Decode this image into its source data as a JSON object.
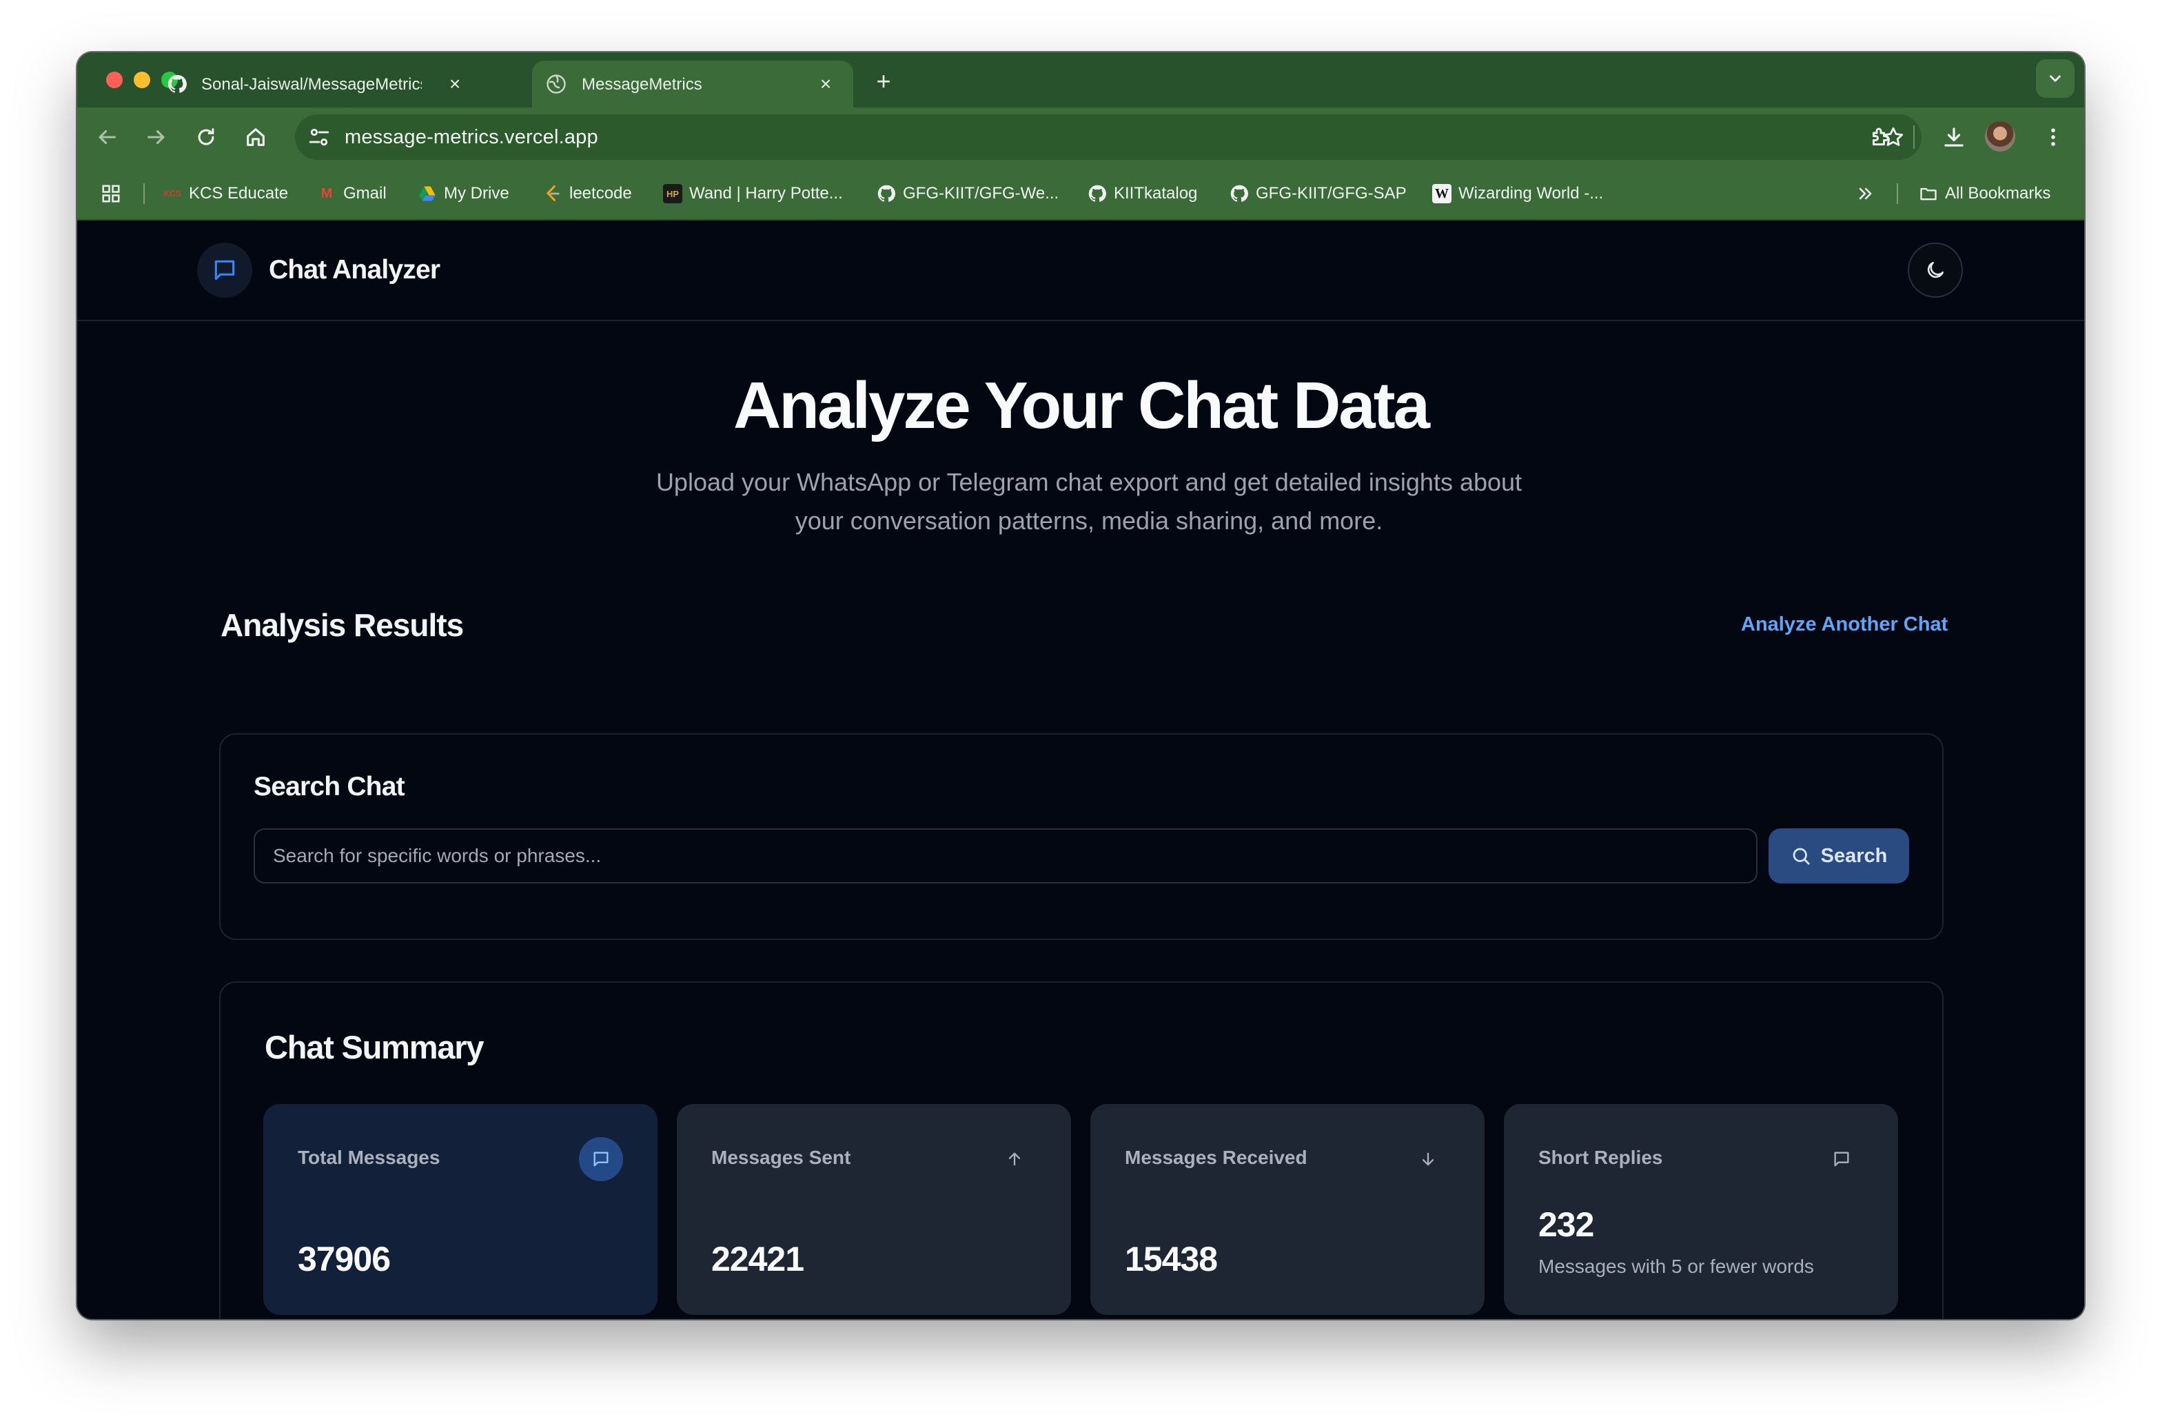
{
  "browser": {
    "tabs": [
      {
        "title": "Sonal-Jaiswal/MessageMetrics",
        "icon": "github-icon"
      },
      {
        "title": "MessageMetrics",
        "icon": "globe-icon"
      }
    ],
    "url": "message-metrics.vercel.app",
    "bookmarks": [
      {
        "label": "KCS Educate",
        "icon": "kcs-icon",
        "icon_text": "KCS"
      },
      {
        "label": "Gmail",
        "icon": "gmail-icon",
        "icon_text": "M"
      },
      {
        "label": "My Drive",
        "icon": "drive-icon"
      },
      {
        "label": "leetcode",
        "icon": "leetcode-icon"
      },
      {
        "label": "Wand | Harry Potte...",
        "icon": "hp-icon",
        "icon_text": "HP"
      },
      {
        "label": "GFG-KIIT/GFG-We...",
        "icon": "github-icon"
      },
      {
        "label": "KIITkatalog",
        "icon": "github-icon"
      },
      {
        "label": "GFG-KIIT/GFG-SAP",
        "icon": "github-icon"
      },
      {
        "label": "Wizarding World -...",
        "icon": "wizarding-icon",
        "icon_text": "W"
      }
    ],
    "all_bookmarks": "All Bookmarks",
    "chrome_color": "#3b6b38"
  },
  "app": {
    "title": "Chat Analyzer",
    "hero": {
      "title": "Analyze Your Chat Data",
      "subtitle": "Upload your WhatsApp or Telegram chat export and get detailed insights about your conversation patterns, media sharing, and more."
    },
    "results": {
      "title": "Analysis Results",
      "analyze_another": "Analyze Another Chat"
    },
    "search": {
      "title": "Search Chat",
      "placeholder": "Search for specific words or phrases...",
      "value": "",
      "button": "Search"
    },
    "summary": {
      "title": "Chat Summary",
      "stats": [
        {
          "label": "Total Messages",
          "value": "37906",
          "icon": "message-icon"
        },
        {
          "label": "Messages Sent",
          "value": "22421",
          "icon": "arrow-up-icon"
        },
        {
          "label": "Messages Received",
          "value": "15438",
          "icon": "arrow-down-icon"
        },
        {
          "label": "Short Replies",
          "value": "232",
          "note": "Messages with 5 or fewer words",
          "icon": "message-icon"
        }
      ]
    },
    "colors": {
      "background": "#030712",
      "accent": "#60a5fa",
      "button": "#2a4b82"
    }
  }
}
